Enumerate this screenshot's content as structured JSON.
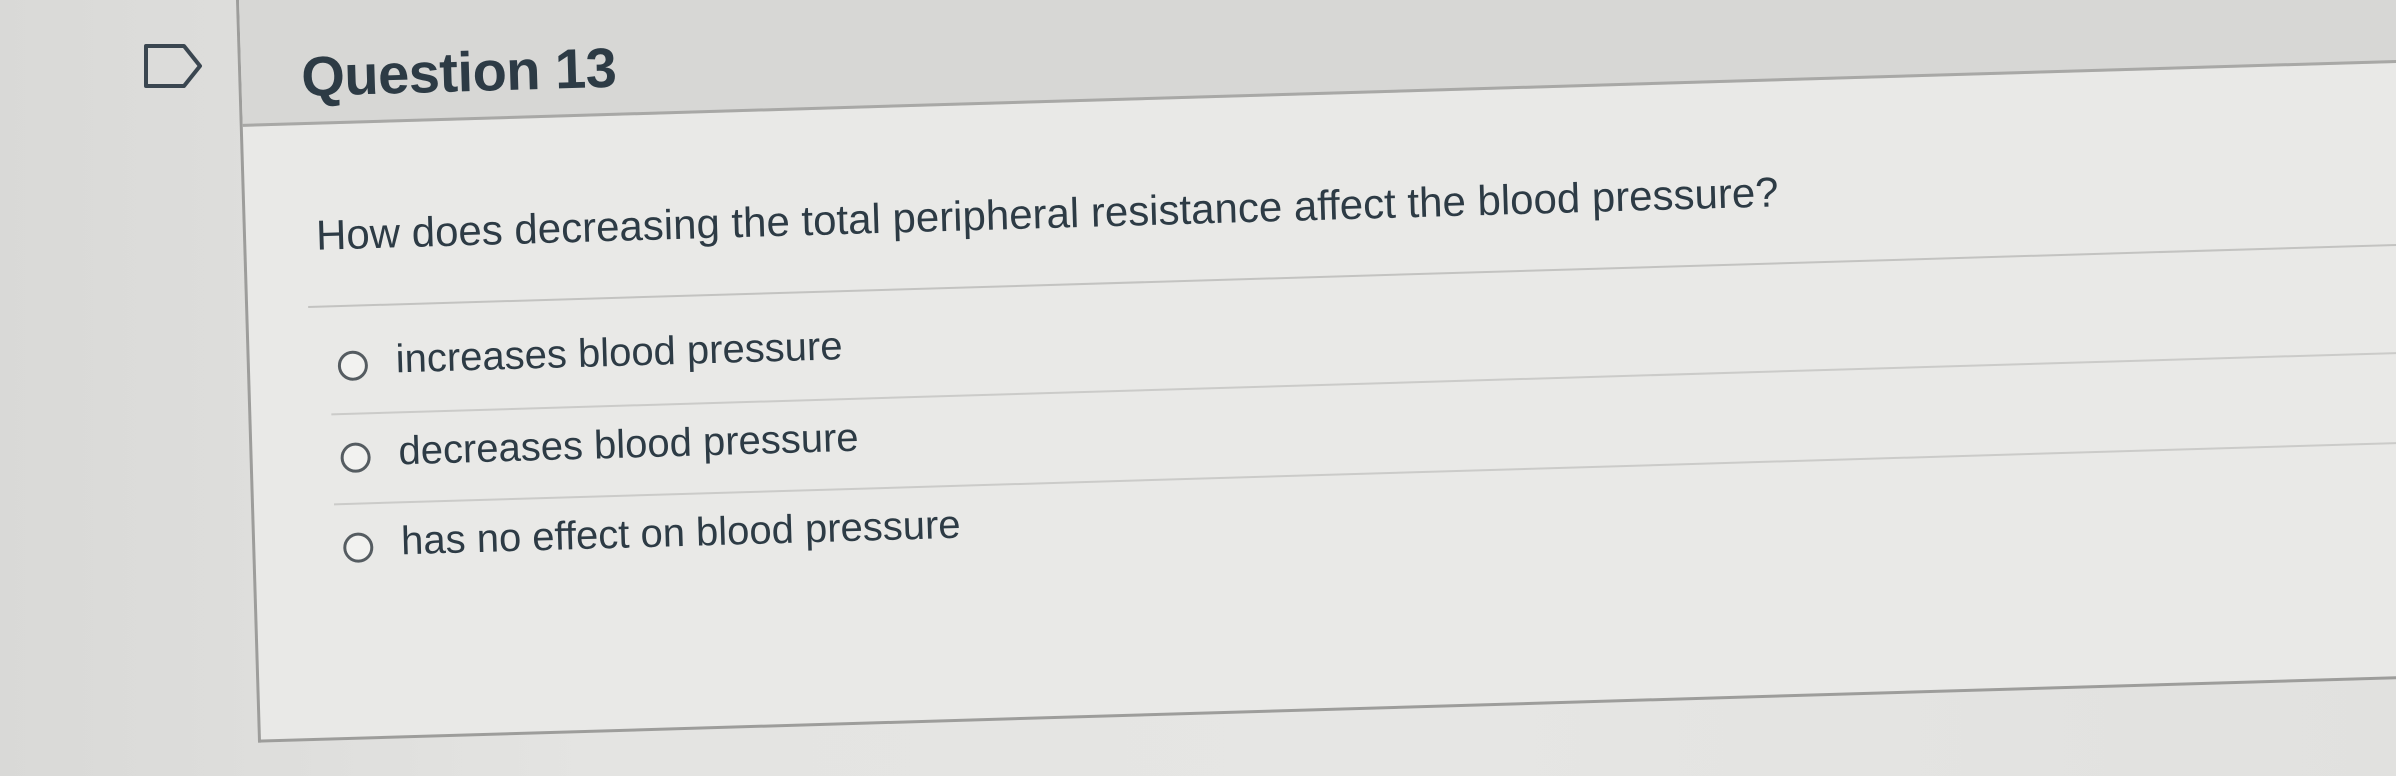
{
  "question": {
    "title": "Question 13",
    "text": "How does decreasing the total peripheral resistance affect the blood pressure?",
    "answers": [
      {
        "label": "increases blood pressure",
        "selected": false
      },
      {
        "label": "decreases blood pressure",
        "selected": false
      },
      {
        "label": "has no effect on blood pressure",
        "selected": false
      }
    ]
  },
  "icons": {
    "flag": "flag-icon",
    "radio": "radio-button-icon"
  },
  "colors": {
    "text": "#2d3b45",
    "header_background": "#d7d7d5",
    "card_background": "#e9e9e7"
  }
}
